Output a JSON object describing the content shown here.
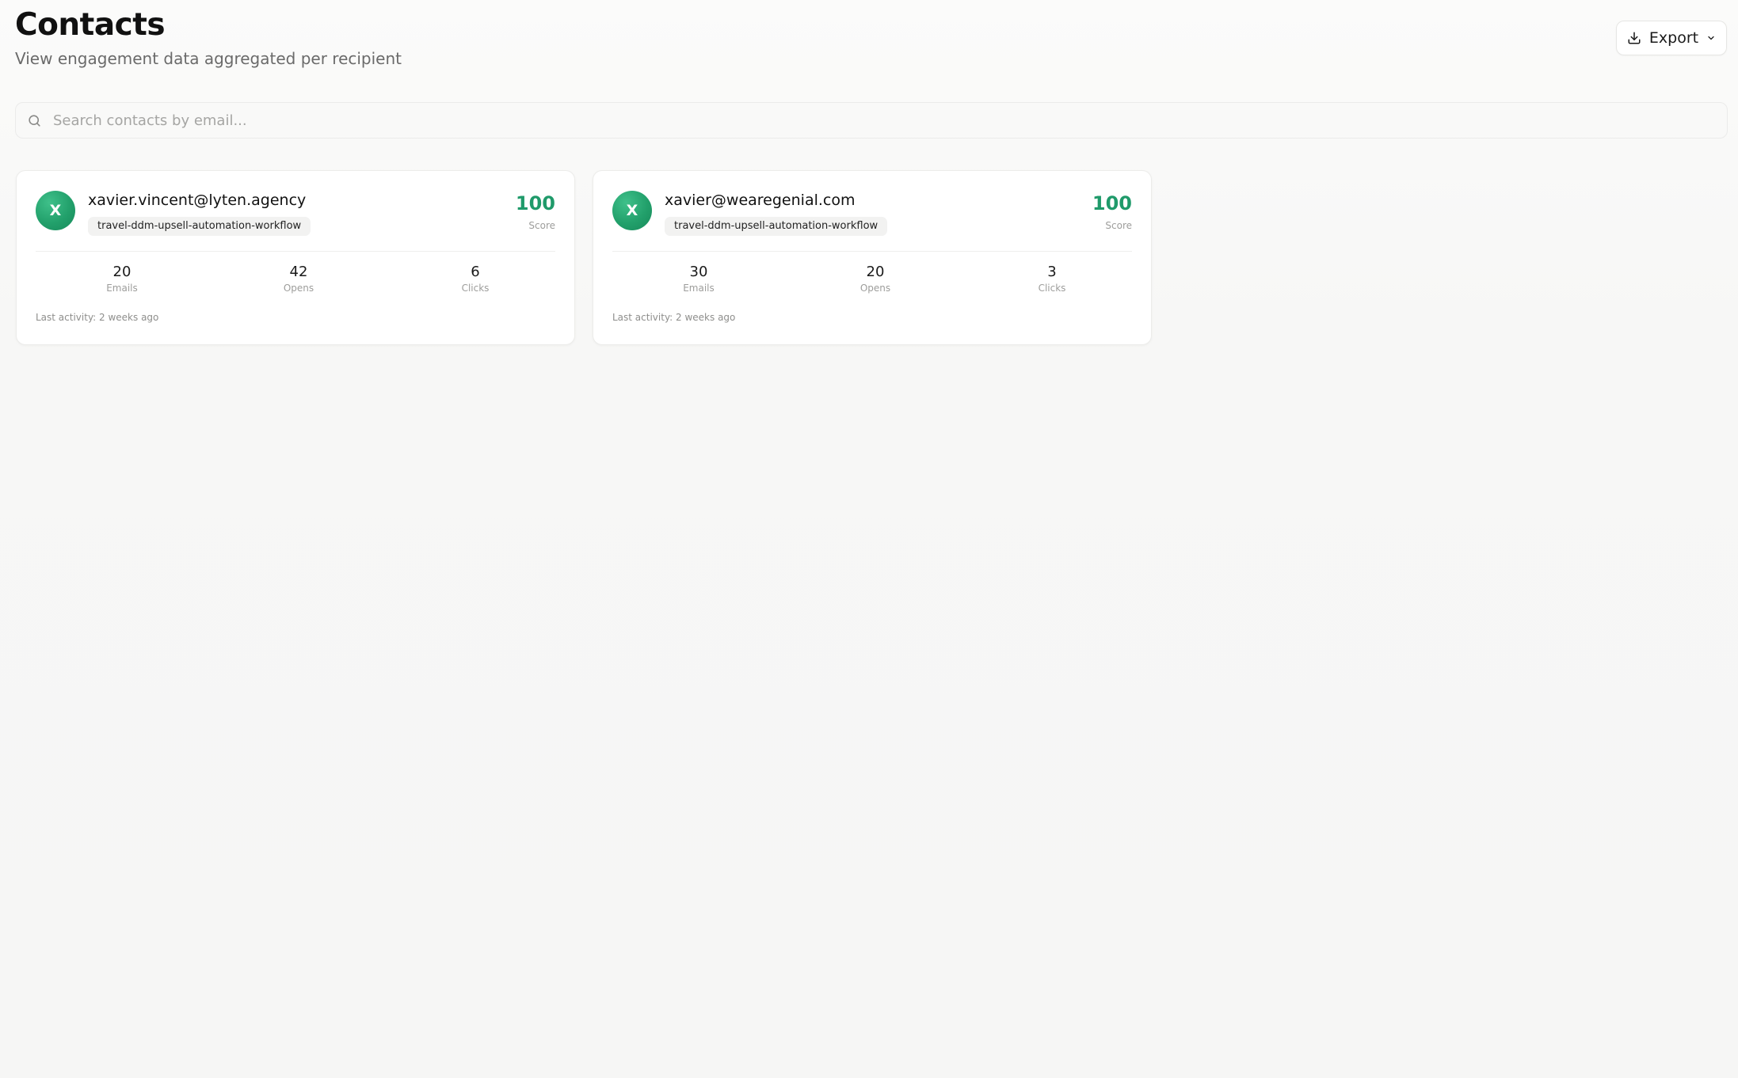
{
  "header": {
    "title": "Contacts",
    "subtitle": "View engagement data aggregated per recipient",
    "export_label": "Export"
  },
  "search": {
    "placeholder": "Search contacts by email...",
    "value": ""
  },
  "colors": {
    "accent": "#1f9a6a",
    "avatar": "#22a06b"
  },
  "icons": {
    "export": "download-icon",
    "export_menu": "chevron-down-icon",
    "search": "search-icon"
  },
  "contacts": [
    {
      "initial": "X",
      "email": "xavier.vincent@lyten.agency",
      "tag": "travel-ddm-upsell-automation-workflow",
      "score": "100",
      "score_label": "Score",
      "emails": "20",
      "emails_label": "Emails",
      "opens": "42",
      "opens_label": "Opens",
      "clicks": "6",
      "clicks_label": "Clicks",
      "last_activity": "Last activity: 2 weeks ago"
    },
    {
      "initial": "X",
      "email": "xavier@wearegenial.com",
      "tag": "travel-ddm-upsell-automation-workflow",
      "score": "100",
      "score_label": "Score",
      "emails": "30",
      "emails_label": "Emails",
      "opens": "20",
      "opens_label": "Opens",
      "clicks": "3",
      "clicks_label": "Clicks",
      "last_activity": "Last activity: 2 weeks ago"
    }
  ]
}
